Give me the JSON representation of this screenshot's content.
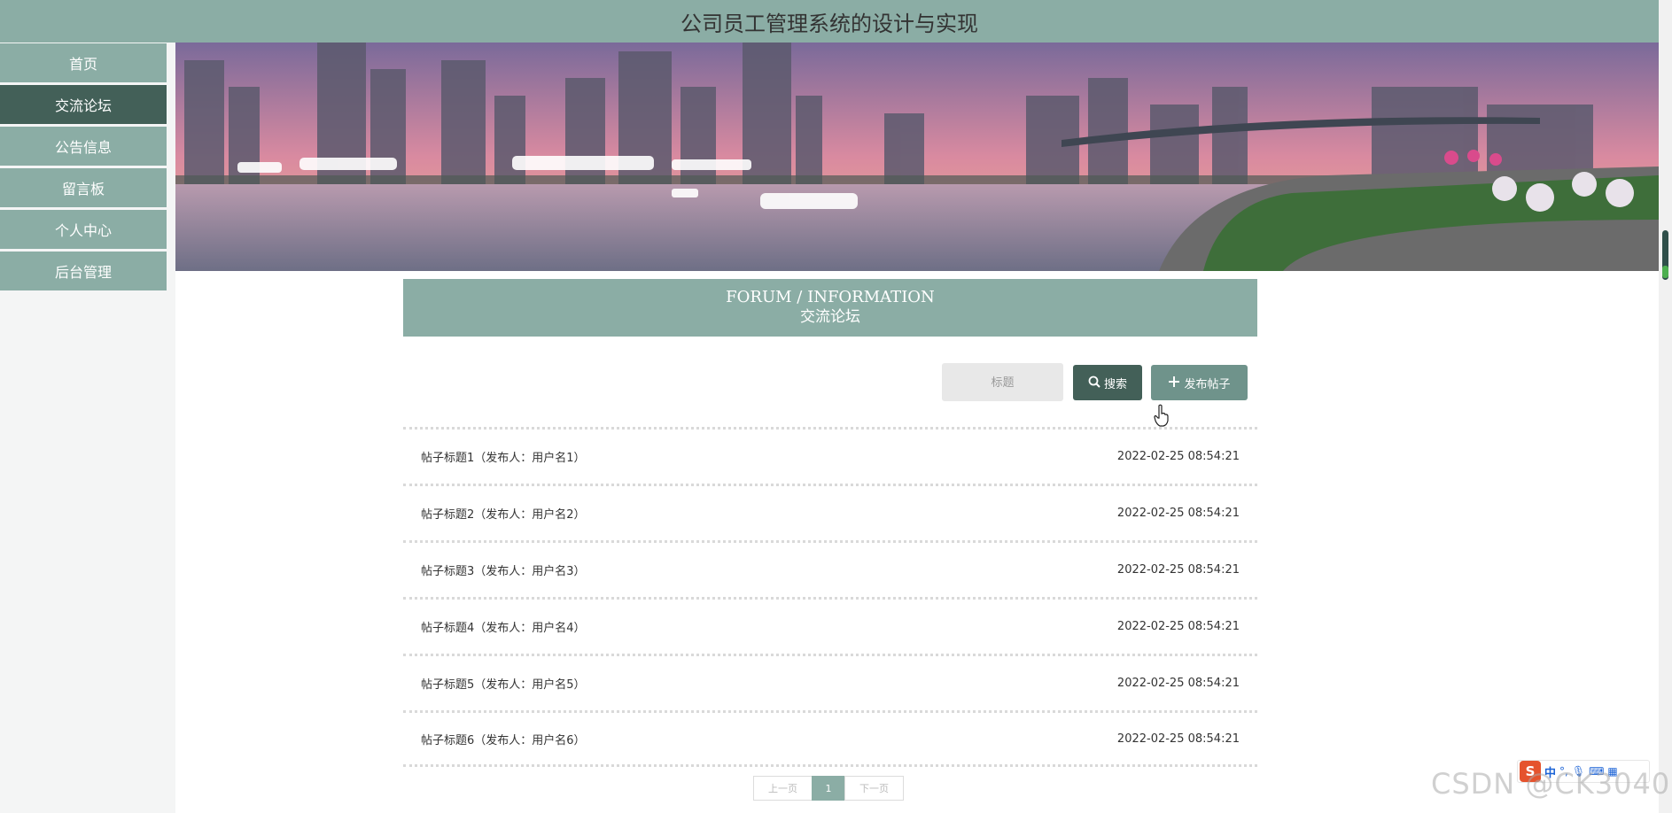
{
  "header": {
    "title": "公司员工管理系统的设计与实现"
  },
  "sidebar": {
    "items": [
      {
        "label": "首页",
        "active": false
      },
      {
        "label": "交流论坛",
        "active": true
      },
      {
        "label": "公告信息",
        "active": false
      },
      {
        "label": "留言板",
        "active": false
      },
      {
        "label": "个人中心",
        "active": false
      },
      {
        "label": "后台管理",
        "active": false
      }
    ]
  },
  "section": {
    "title_en": "FORUM / INFORMATION",
    "title_cn": "交流论坛"
  },
  "search": {
    "placeholder": "标题",
    "search_label": "搜索",
    "add_label": "发布帖子"
  },
  "posts": [
    {
      "title": "帖子标题1（发布人：用户名1）",
      "time": "2022-02-25 08:54:21"
    },
    {
      "title": "帖子标题2（发布人：用户名2）",
      "time": "2022-02-25 08:54:21"
    },
    {
      "title": "帖子标题3（发布人：用户名3）",
      "time": "2022-02-25 08:54:21"
    },
    {
      "title": "帖子标题4（发布人：用户名4）",
      "time": "2022-02-25 08:54:21"
    },
    {
      "title": "帖子标题5（发布人：用户名5）",
      "time": "2022-02-25 08:54:21"
    },
    {
      "title": "帖子标题6（发布人：用户名6）",
      "time": "2022-02-25 08:54:21"
    }
  ],
  "pagination": {
    "prev_label": "上一页",
    "current": "1",
    "next_label": "下一页"
  },
  "ime": {
    "logo": "S",
    "mode": "中"
  },
  "watermark": "CSDN @CK3040",
  "colors": {
    "primary": "#8bada5",
    "dark": "#436058"
  }
}
